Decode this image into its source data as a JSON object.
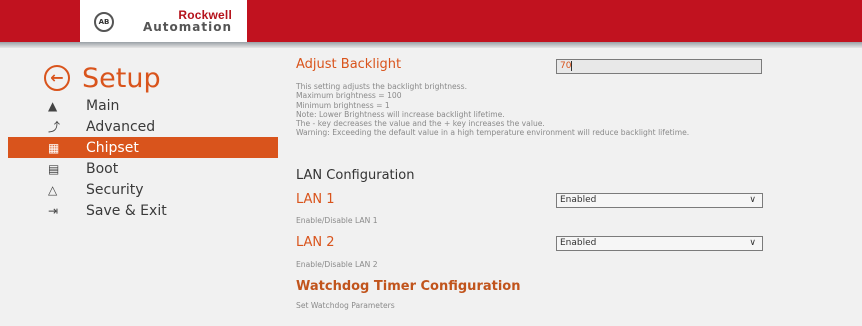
{
  "header": {
    "badge": "AB",
    "brand_line1": "Rockwell",
    "brand_line2": "Automation"
  },
  "sidebar": {
    "title": "Setup",
    "items": [
      {
        "label": "Main",
        "icon": "home-icon"
      },
      {
        "label": "Advanced",
        "icon": "wrench-icon"
      },
      {
        "label": "Chipset",
        "icon": "chip-icon"
      },
      {
        "label": "Boot",
        "icon": "boot-icon"
      },
      {
        "label": "Security",
        "icon": "lock-icon"
      },
      {
        "label": "Save & Exit",
        "icon": "exit-icon"
      }
    ],
    "active_item": "Chipset"
  },
  "main": {
    "backlight": {
      "title": "Adjust Backlight",
      "value": "70",
      "help": [
        "This setting adjusts the backlight brightness.",
        "Maximum brightness = 100",
        "Minimum brightness = 1",
        "Note: Lower Brightness will increase backlight lifetime.",
        "The - key decreases the value and the + key increases the value.",
        "Warning: Exceeding the default value in a high temperature environment will reduce backlight lifetime."
      ]
    },
    "lan_config": {
      "heading": "LAN Configuration",
      "lan1": {
        "label": "LAN 1",
        "value": "Enabled",
        "help": "Enable/Disable LAN 1"
      },
      "lan2": {
        "label": "LAN 2",
        "value": "Enabled",
        "help": "Enable/Disable LAN 2"
      }
    },
    "watchdog": {
      "heading": "Watchdog Timer Configuration",
      "help": "Set Watchdog Parameters"
    }
  },
  "colors": {
    "brand_red": "#c1121f",
    "accent_orange": "#d9541c",
    "background": "#f1f1f1"
  }
}
